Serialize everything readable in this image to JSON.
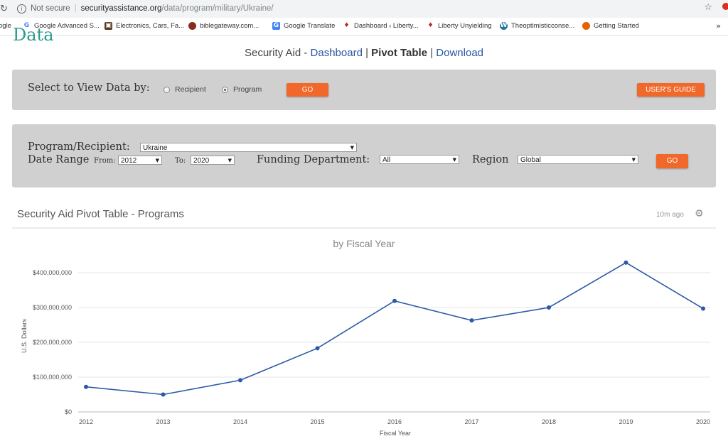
{
  "browser": {
    "security_label": "Not secure",
    "url_domain": "securityassistance.org",
    "url_path": "/data/program/military/Ukraine/",
    "bookmarks": [
      {
        "label": "ogle",
        "icon": "google-icon"
      },
      {
        "label": "Google Advanced S...",
        "icon": "google-icon"
      },
      {
        "label": "Electronics, Cars, Fa...",
        "icon": "store-icon"
      },
      {
        "label": "biblegateway.com...",
        "icon": "book-icon"
      },
      {
        "label": "Google Translate",
        "icon": "translate-icon"
      },
      {
        "label": "Dashboard ‹ Liberty...",
        "icon": "flame-icon"
      },
      {
        "label": "Liberty Unyielding",
        "icon": "flame-icon"
      },
      {
        "label": "Theoptimisticconse...",
        "icon": "wordpress-icon"
      },
      {
        "label": "Getting Started",
        "icon": "firefox-icon"
      }
    ]
  },
  "page": {
    "logo_fragment": "Data",
    "subnav": {
      "prefix": "Security Aid - ",
      "dashboard": "Dashboard",
      "pipe1": " | ",
      "pivot": "Pivot Table",
      "pipe2": " | ",
      "download": "Download"
    }
  },
  "view_panel": {
    "label": "Select to View Data by:",
    "options": [
      "Recipient",
      "Program"
    ],
    "selected": "Program",
    "go": "GO",
    "guide": "USER'S GUIDE"
  },
  "filter_panel": {
    "program_label": "Program/Recipient:",
    "program_value": "Ukraine",
    "date_label": "Date Range",
    "from_label": "From:",
    "from_value": "2012",
    "to_label": "To:",
    "to_value": "2020",
    "funding_label": "Funding Department:",
    "funding_value": "All",
    "region_label": "Region",
    "region_value": "Global",
    "go": "GO"
  },
  "pivot": {
    "title": "Security Aid Pivot Table - Programs",
    "updated": "10m ago"
  },
  "colors": {
    "accent": "#f0692b",
    "line": "#2b5aa5",
    "link": "#2b55a5",
    "teal": "#2b9a8e"
  },
  "chart_data": {
    "type": "line",
    "title": "by Fiscal Year",
    "xlabel": "Fiscal Year",
    "ylabel": "U.S. Dollars",
    "x": [
      "2012",
      "2013",
      "2014",
      "2015",
      "2016",
      "2017",
      "2018",
      "2019",
      "2020"
    ],
    "series": [
      {
        "values": [
          72000000,
          50000000,
          91000000,
          183000000,
          319000000,
          263000000,
          300000000,
          429000000,
          297000000
        ]
      }
    ],
    "ylim": [
      0,
      400000000
    ],
    "yticks": [
      "$0",
      "$100,000,000",
      "$200,000,000",
      "$300,000,000",
      "$400,000,000"
    ],
    "grid": true
  }
}
